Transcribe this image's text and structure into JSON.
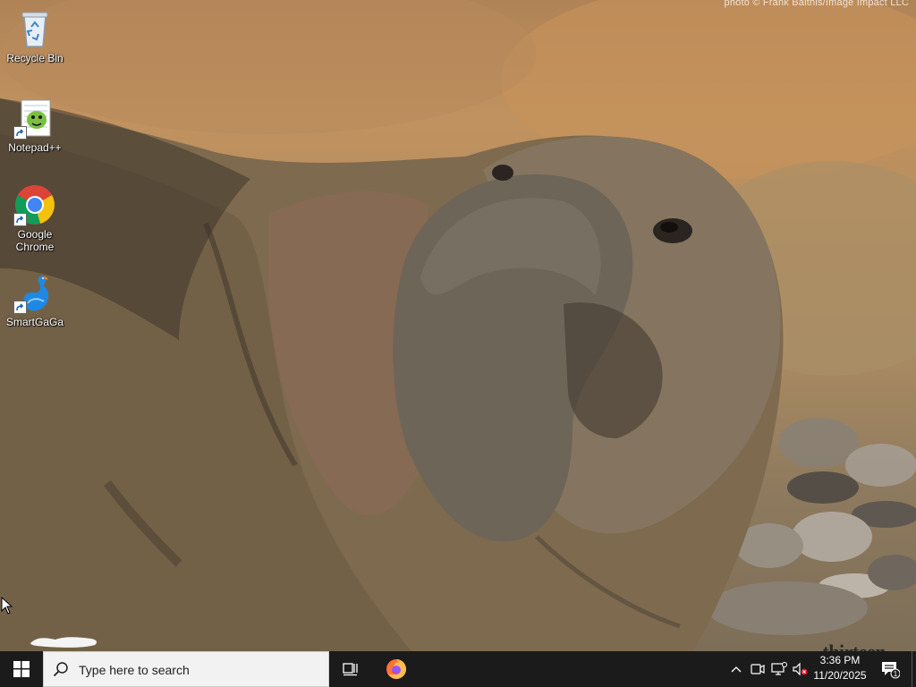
{
  "wallpaper": {
    "credit": "photo © Frank Balthis/Image Impact LLC",
    "watermark": "thirteen"
  },
  "desktop_icons": [
    {
      "label": "Recycle Bin",
      "icon": "recycle-bin-icon"
    },
    {
      "label": "Notepad++",
      "icon": "notepad-plus-plus-icon"
    },
    {
      "label": "Google Chrome",
      "icon": "chrome-icon"
    },
    {
      "label": "SmartGaGa",
      "icon": "smartgaga-icon"
    }
  ],
  "taskbar": {
    "search_placeholder": "Type here to search",
    "pinned": [
      {
        "name": "task-view",
        "icon": "task-view-icon"
      },
      {
        "name": "firefox",
        "icon": "firefox-icon"
      }
    ],
    "tray_icons": [
      "chevron-up-icon",
      "meet-now-icon",
      "network-icon",
      "volume-muted-icon"
    ],
    "clock": {
      "time": "3:36 PM",
      "date": "11/20/2025"
    },
    "notification_count": "1"
  },
  "colors": {
    "taskbar_bg": "#1b1b1b",
    "search_bg": "#f2f2f2",
    "start_icon": "#ffffff",
    "chrome_red": "#db4437",
    "chrome_yellow": "#f4c20d",
    "chrome_green": "#0f9d58",
    "chrome_blue": "#4285f4",
    "smartgaga_blue": "#1e88e5"
  }
}
